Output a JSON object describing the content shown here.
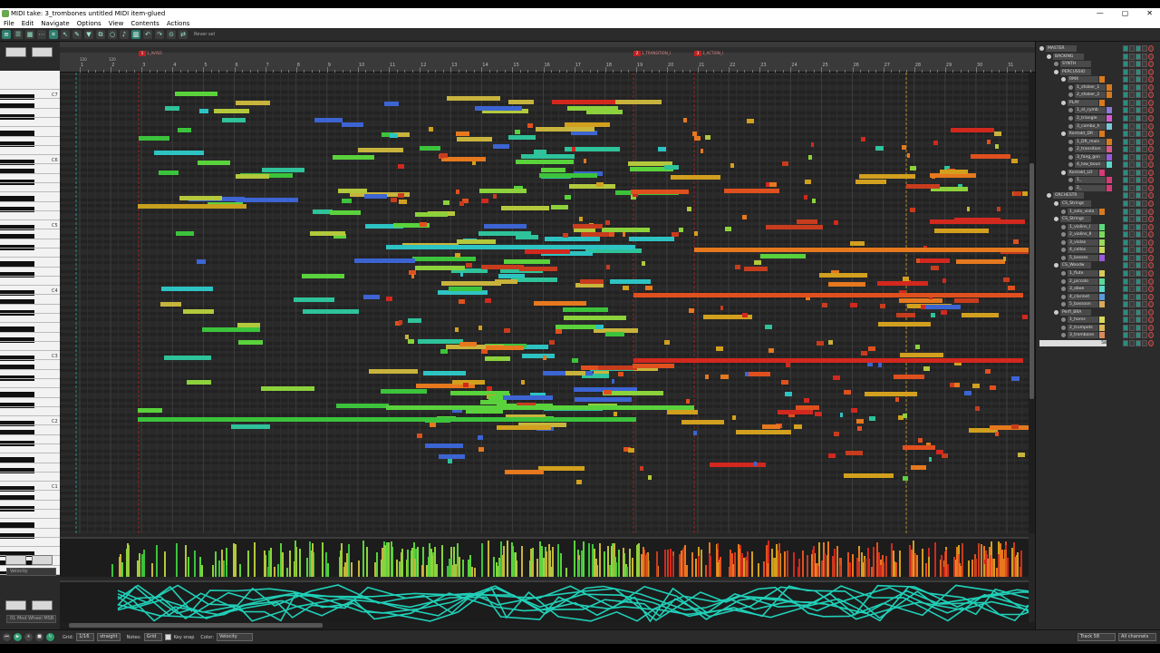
{
  "window": {
    "title": "MIDI take: 3_trombones untitled MIDI item-glued",
    "buttons": [
      "—",
      "▢",
      "✕"
    ]
  },
  "menu": [
    "File",
    "Edit",
    "Navigate",
    "Options",
    "View",
    "Contents",
    "Actions"
  ],
  "toolbar": {
    "reverse_label": "Rever sel",
    "icons": [
      "midi-editor-icon",
      "list-icon",
      "piano-roll-icon",
      "dots-icon",
      "snap-icon",
      "cursor-icon",
      "filter-icon",
      "merge-icon",
      "loop-icon",
      "metronome-icon",
      "grid-icon",
      "undo-icon",
      "redo-icon",
      "step-input-icon",
      "reverse-icon"
    ]
  },
  "ruler": {
    "markers": [
      {
        "num": "1",
        "label": "1_AVISO"
      },
      {
        "num": "2",
        "label": "2_TRANSITION_I"
      },
      {
        "num": "3",
        "label": "3_ACTION_I"
      }
    ],
    "bars": [
      "1",
      "2",
      "3",
      "4",
      "5",
      "6",
      "7",
      "8",
      "9",
      "10",
      "11",
      "12",
      "13",
      "14",
      "15",
      "16",
      "17",
      "18",
      "19",
      "20",
      "21",
      "22",
      "23",
      "24",
      "25",
      "26",
      "27",
      "28",
      "29",
      "30",
      "31"
    ],
    "sub_labels": [
      "120",
      "120"
    ]
  },
  "keyboard": {
    "octave_labels": [
      "C7",
      "C6",
      "C5",
      "C4",
      "C3",
      "C2",
      "C1"
    ]
  },
  "lanes": {
    "velocity_label": "Velocity",
    "cc_label": "01 Mod Wheel MSB"
  },
  "tracks": [
    {
      "name": "MASTER",
      "indent": 0,
      "color": "",
      "folder": true
    },
    {
      "name": "BACKING",
      "indent": 1,
      "color": "",
      "folder": true
    },
    {
      "name": "SYNTH",
      "indent": 2,
      "color": "",
      "folder": false
    },
    {
      "name": "PERCUSSIO",
      "indent": 2,
      "color": "",
      "folder": true
    },
    {
      "name": "RMX",
      "indent": 3,
      "color": "#d97a1e",
      "folder": true
    },
    {
      "name": "1_shaker_1",
      "indent": 4,
      "color": "#d97a1e",
      "folder": false
    },
    {
      "name": "2_shaker_2",
      "indent": 4,
      "color": "#d97a1e",
      "folder": false
    },
    {
      "name": "PLAY",
      "indent": 3,
      "color": "#d97a1e",
      "folder": true
    },
    {
      "name": "1_el_cymb",
      "indent": 4,
      "color": "#8a7ad9",
      "folder": false
    },
    {
      "name": "2_triangle",
      "indent": 4,
      "color": "#d95ad0",
      "folder": false
    },
    {
      "name": "3_combo_h",
      "indent": 4,
      "color": "#7ac9d9",
      "folder": false
    },
    {
      "name": "Kontakt_DR",
      "indent": 3,
      "color": "#d97a1e",
      "folder": true
    },
    {
      "name": "1_DR_main",
      "indent": 4,
      "color": "#d97a1e",
      "folder": false
    },
    {
      "name": "2_transition",
      "indent": 4,
      "color": "#d95a8a",
      "folder": false
    },
    {
      "name": "3_fang_gon",
      "indent": 4,
      "color": "#9a5ad9",
      "folder": false
    },
    {
      "name": "4_low_boun",
      "indent": 4,
      "color": "#5ad9c9",
      "folder": false
    },
    {
      "name": "Kontakt_LO",
      "indent": 3,
      "color": "#d93a7a",
      "folder": true
    },
    {
      "name": "1_",
      "indent": 4,
      "color": "#d93a7a",
      "folder": false
    },
    {
      "name": "2_",
      "indent": 4,
      "color": "#d93a7a",
      "folder": false
    },
    {
      "name": "ORCHESTR",
      "indent": 1,
      "color": "",
      "folder": true
    },
    {
      "name": "CS_Strings",
      "indent": 2,
      "color": "",
      "folder": true
    },
    {
      "name": "1_solo_viola",
      "indent": 3,
      "color": "#d97a1e",
      "folder": false
    },
    {
      "name": "CS_Strings",
      "indent": 2,
      "color": "",
      "folder": true
    },
    {
      "name": "1_violins_I",
      "indent": 3,
      "color": "#5ad97a",
      "folder": false
    },
    {
      "name": "2_violins_II",
      "indent": 3,
      "color": "#7ad95a",
      "folder": false
    },
    {
      "name": "3_violas",
      "indent": 3,
      "color": "#9ad95a",
      "folder": false
    },
    {
      "name": "4_cellos",
      "indent": 3,
      "color": "#c9d95a",
      "folder": false
    },
    {
      "name": "5_basses",
      "indent": 3,
      "color": "#9a5ad9",
      "folder": false
    },
    {
      "name": "CS_Woodw",
      "indent": 2,
      "color": "",
      "folder": true
    },
    {
      "name": "1_flute",
      "indent": 3,
      "color": "#d9c95a",
      "folder": false
    },
    {
      "name": "2_piccolo",
      "indent": 3,
      "color": "#5ad99a",
      "folder": false
    },
    {
      "name": "3_oboe",
      "indent": 3,
      "color": "#5ad9c9",
      "folder": false
    },
    {
      "name": "4_clarinet",
      "indent": 3,
      "color": "#5a9ad9",
      "folder": false
    },
    {
      "name": "5_bassoon",
      "indent": 3,
      "color": "#d9a95a",
      "folder": false
    },
    {
      "name": "Perfl_BRA",
      "indent": 2,
      "color": "",
      "folder": true
    },
    {
      "name": "1_horns",
      "indent": 3,
      "color": "#d9d95a",
      "folder": false
    },
    {
      "name": "2_trumpets",
      "indent": 3,
      "color": "#d9b95a",
      "folder": false
    },
    {
      "name": "3_trombone",
      "indent": 3,
      "color": "#d98a5a",
      "folder": false
    },
    {
      "name": "58",
      "indent": 0,
      "color": "",
      "folder": false
    }
  ],
  "status": {
    "grid_label": "Grid:",
    "grid_value": "1/16",
    "swing_value": "straight",
    "notes_label": "Notes:",
    "notes_value": "Grid",
    "keysnap_label": "Key snap",
    "color_label": "Color:",
    "color_value": "Velocity",
    "track_value": "Track 58",
    "channels_value": "All channels"
  },
  "colors": {
    "accent": "#2e7d6e",
    "marker": "#b22222",
    "cc_curve": "#20d0b8"
  }
}
